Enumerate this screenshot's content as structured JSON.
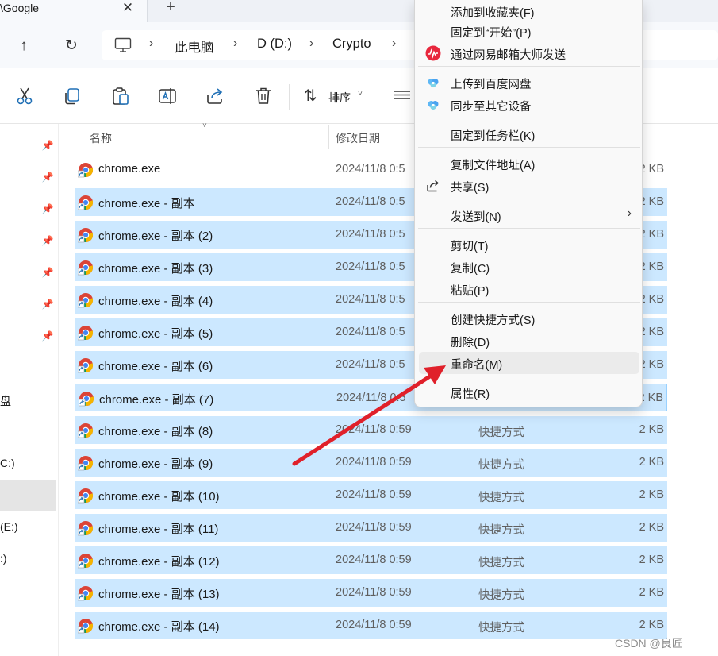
{
  "tab": {
    "title": "\\Google",
    "close": "✕",
    "new": "+"
  },
  "nav": {
    "up": "↑",
    "refresh": "↻"
  },
  "address": {
    "crumbs": [
      "此电脑",
      "D (D:)",
      "Crypto"
    ],
    "sep": "›"
  },
  "toolbar": {
    "sort_label": "排序",
    "sort_caret": "˅",
    "sort_icon": "⇅"
  },
  "sidebar": {
    "pin": "📌",
    "items": [
      "盘",
      "C:)",
      "(E:)",
      ":)"
    ]
  },
  "columns": {
    "name": "名称",
    "date": "修改日期",
    "sort_caret": "˅"
  },
  "files": [
    {
      "name": "chrome.exe",
      "date": "2024/11/8 0:5",
      "type": "",
      "size": "2 KB",
      "state": "normal"
    },
    {
      "name": "chrome.exe - 副本",
      "date": "2024/11/8 0:5",
      "type": "",
      "size": "2 KB",
      "state": "selected"
    },
    {
      "name": "chrome.exe - 副本 (2)",
      "date": "2024/11/8 0:5",
      "type": "",
      "size": "2 KB",
      "state": "selected"
    },
    {
      "name": "chrome.exe - 副本 (3)",
      "date": "2024/11/8 0:5",
      "type": "",
      "size": "2 KB",
      "state": "selected"
    },
    {
      "name": "chrome.exe - 副本 (4)",
      "date": "2024/11/8 0:5",
      "type": "",
      "size": "2 KB",
      "state": "selected"
    },
    {
      "name": "chrome.exe - 副本 (5)",
      "date": "2024/11/8 0:5",
      "type": "",
      "size": "2 KB",
      "state": "selected"
    },
    {
      "name": "chrome.exe - 副本 (6)",
      "date": "2024/11/8 0:5",
      "type": "",
      "size": "2 KB",
      "state": "selected"
    },
    {
      "name": "chrome.exe - 副本 (7)",
      "date": "2024/11/8 0:5",
      "type": "",
      "size": "2 KB",
      "state": "focused"
    },
    {
      "name": "chrome.exe - 副本 (8)",
      "date": "2024/11/8 0:59",
      "type": "快捷方式",
      "size": "2 KB",
      "state": "selected"
    },
    {
      "name": "chrome.exe - 副本 (9)",
      "date": "2024/11/8 0:59",
      "type": "快捷方式",
      "size": "2 KB",
      "state": "selected"
    },
    {
      "name": "chrome.exe - 副本 (10)",
      "date": "2024/11/8 0:59",
      "type": "快捷方式",
      "size": "2 KB",
      "state": "selected"
    },
    {
      "name": "chrome.exe - 副本 (11)",
      "date": "2024/11/8 0:59",
      "type": "快捷方式",
      "size": "2 KB",
      "state": "selected"
    },
    {
      "name": "chrome.exe - 副本 (12)",
      "date": "2024/11/8 0:59",
      "type": "快捷方式",
      "size": "2 KB",
      "state": "selected"
    },
    {
      "name": "chrome.exe - 副本 (13)",
      "date": "2024/11/8 0:59",
      "type": "快捷方式",
      "size": "2 KB",
      "state": "selected"
    },
    {
      "name": "chrome.exe - 副本 (14)",
      "date": "2024/11/8 0:59",
      "type": "快捷方式",
      "size": "2 KB",
      "state": "selected"
    }
  ],
  "context_menu": {
    "items": [
      {
        "label": "添加到收藏夹(F)",
        "icon": ""
      },
      {
        "label": "固定到“开始”(P)",
        "icon": ""
      },
      {
        "label": "通过网易邮箱大师发送",
        "icon": "netease-mail-icon"
      },
      {
        "label": "上传到百度网盘",
        "icon": "baidu-netdisk-icon"
      },
      {
        "label": "同步至其它设备",
        "icon": "baidu-netdisk-icon"
      },
      {
        "label": "固定到任务栏(K)",
        "icon": ""
      },
      {
        "label": "复制文件地址(A)",
        "icon": ""
      },
      {
        "label": "共享(S)",
        "icon": "share-icon"
      },
      {
        "label": "发送到(N)",
        "icon": "",
        "submenu": "›"
      },
      {
        "label": "剪切(T)",
        "icon": ""
      },
      {
        "label": "复制(C)",
        "icon": ""
      },
      {
        "label": "粘贴(P)",
        "icon": ""
      },
      {
        "label": "创建快捷方式(S)",
        "icon": ""
      },
      {
        "label": "删除(D)",
        "icon": ""
      },
      {
        "label": "重命名(M)",
        "icon": "",
        "hover": true
      },
      {
        "label": "属性(R)",
        "icon": ""
      }
    ]
  },
  "colors": {
    "selection": "#cce8ff",
    "selection_border": "#99d1ff",
    "annotation_arrow": "#e0202a",
    "netease_red": "#e8273d"
  },
  "watermark": "CSDN @良匠"
}
